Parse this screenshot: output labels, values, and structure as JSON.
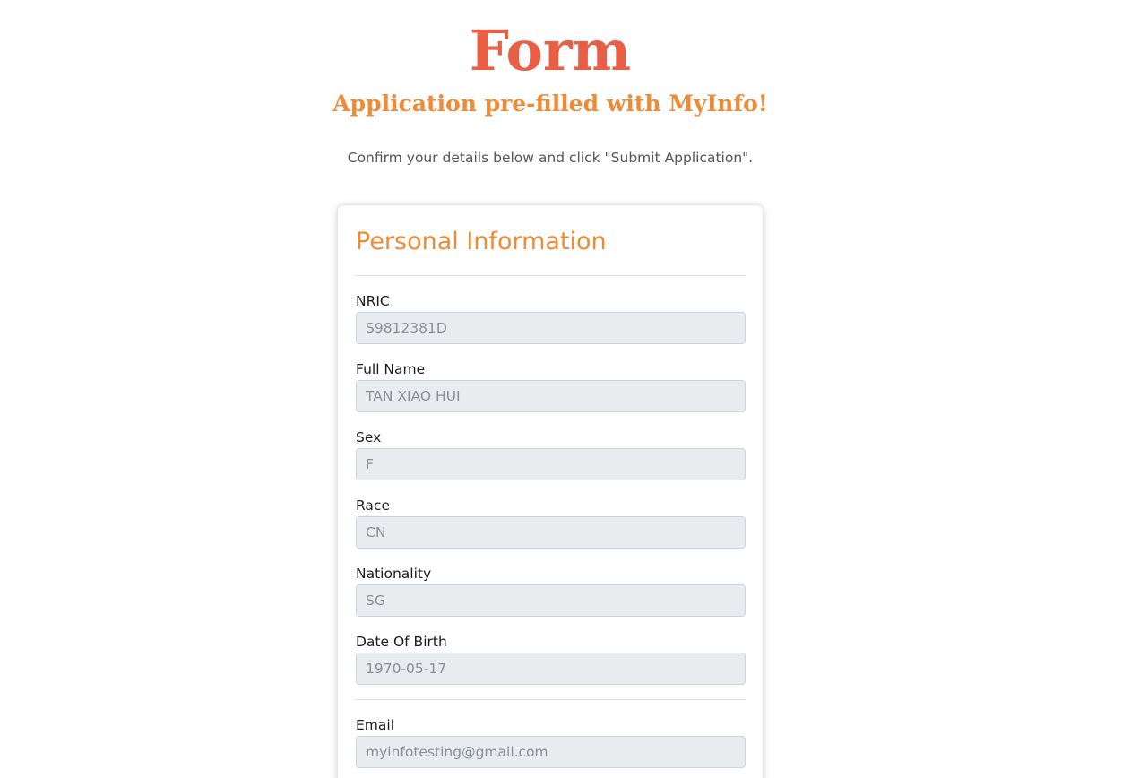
{
  "header": {
    "title": "Form",
    "subtitle": "Application pre-filled with MyInfo!",
    "instructions": "Confirm your details below and click \"Submit Application\"."
  },
  "personal_info": {
    "section_title": "Personal Information",
    "fields": [
      {
        "label": "NRIC",
        "value": "S9812381D"
      },
      {
        "label": "Full Name",
        "value": "TAN XIAO HUI"
      },
      {
        "label": "Sex",
        "value": "F"
      },
      {
        "label": "Race",
        "value": "CN"
      },
      {
        "label": "Nationality",
        "value": "SG"
      },
      {
        "label": "Date Of Birth",
        "value": "1970-05-17"
      }
    ]
  },
  "contact": {
    "fields": [
      {
        "label": "Email",
        "value": "myinfotesting@gmail.com"
      }
    ]
  },
  "colors": {
    "title": "#e85f45",
    "accent": "#ef8b35",
    "input_bg": "#e9ecef"
  }
}
